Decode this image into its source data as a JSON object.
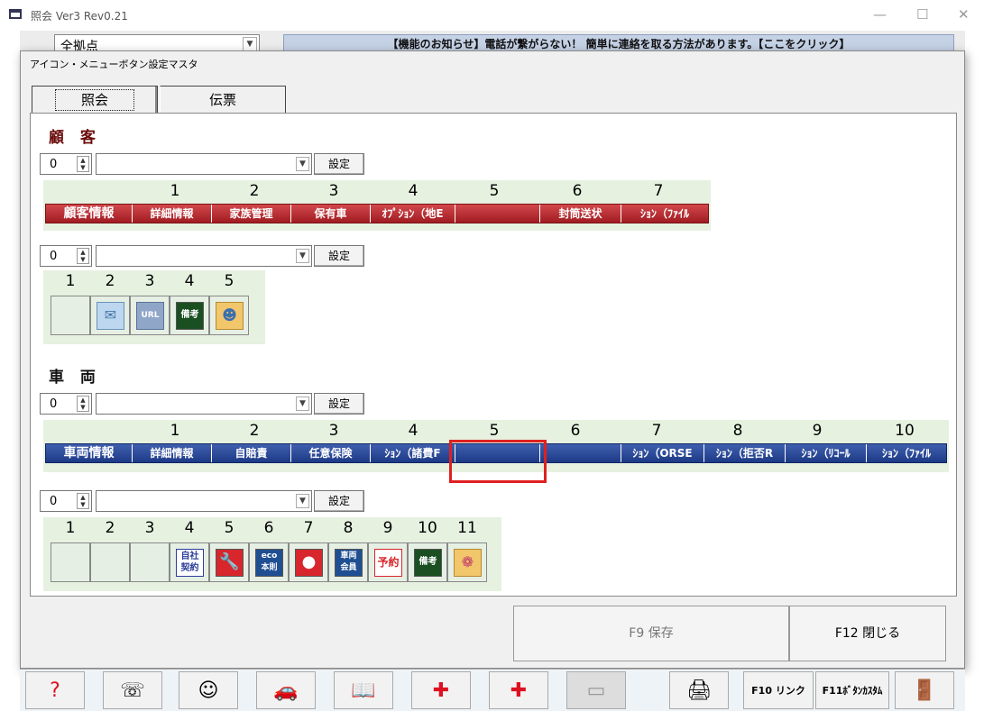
{
  "window": {
    "title": "照会 Ver3 Rev0.21",
    "minimize": "—",
    "maximize": "☐",
    "close": "✕"
  },
  "background": {
    "location_combo": "全拠点",
    "notice": "【機能のお知らせ】電話が繋がらない！ 簡単に連絡を取る方法があります。【ここをクリック】",
    "toolbar_labels": [
      "F10 リンク",
      "F11ﾎﾞﾀﾝｶｽﾀﾑ"
    ]
  },
  "dialog": {
    "title": "アイコン・メニューボタン設定マスタ",
    "tabs": [
      "照会",
      "伝票"
    ],
    "customer": {
      "heading": "顧 客",
      "menu_spin": "0",
      "menu_set": "設定",
      "menu_numbers": [
        "1",
        "2",
        "3",
        "4",
        "5",
        "6",
        "7"
      ],
      "menu_bar": [
        "顧客情報",
        "詳細情報",
        "家族管理",
        "保有車",
        "ｵﾌﾟｼｮﾝ（地E",
        "",
        "封筒送状",
        "ｼｮﾝ（ﾌｧｲﾙ"
      ],
      "icon_spin": "0",
      "icon_set": "設定",
      "icon_numbers": [
        "1",
        "2",
        "3",
        "4",
        "5"
      ],
      "icons": [
        "",
        "mail-icon",
        "url-icon",
        "memo-icon",
        "folder-person-icon"
      ],
      "icon_texts": {
        "url": "URL",
        "memo": "備考"
      }
    },
    "vehicle": {
      "heading": "車 両",
      "menu_spin": "0",
      "menu_set": "設定",
      "menu_numbers": [
        "1",
        "2",
        "3",
        "4",
        "5",
        "6",
        "7",
        "8",
        "9",
        "10"
      ],
      "menu_bar": [
        "車両情報",
        "詳細情報",
        "自賠責",
        "任意保険",
        "ｼｮﾝ（諸費F",
        "",
        "",
        "ｼｮﾝ（ORSE",
        "ｼｮﾝ（拒否R",
        "ｼｮﾝ（ﾘｺｰﾙ",
        "ｼｮﾝ（ﾌｧｲﾙ"
      ],
      "icon_spin": "0",
      "icon_set": "設定",
      "icon_numbers": [
        "1",
        "2",
        "3",
        "4",
        "5",
        "6",
        "7",
        "8",
        "9",
        "10",
        "11"
      ],
      "icons": [
        "",
        "",
        "",
        "company-contract-icon",
        "wrench-icon",
        "eco-icon",
        "red-tag-icon",
        "vehicle-member-icon",
        "reservation-icon",
        "memo-icon",
        "folder-icon"
      ],
      "icon_texts": {
        "company": "自社\n契約",
        "eco": "eco\n本則",
        "member": "車両\n会員",
        "reserve": "予約",
        "memo": "備考"
      }
    },
    "buttons": {
      "save": "F9 保存",
      "close": "F12 閉じる"
    }
  },
  "colors": {
    "red_bar": "#b02a2e",
    "blue_bar": "#1f3d8a",
    "highlight": "#e02020",
    "heading": "#6b0b0b"
  }
}
